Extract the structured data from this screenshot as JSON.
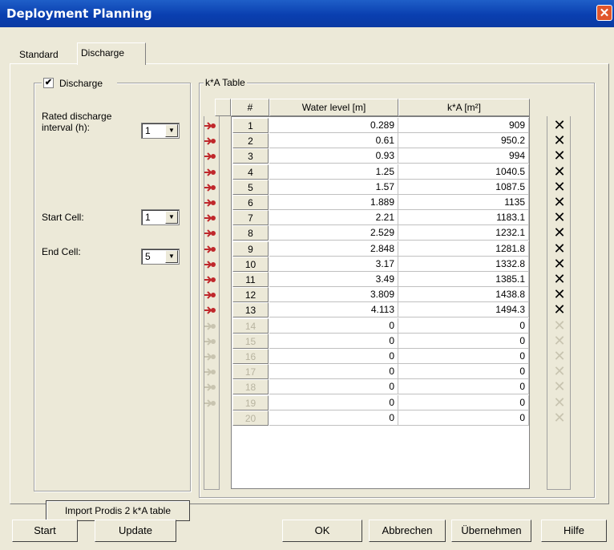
{
  "window": {
    "title": "Deployment Planning",
    "close_glyph": "✕"
  },
  "tabs": [
    {
      "label": "Standard"
    },
    {
      "label": "Discharge"
    }
  ],
  "discharge_group": {
    "checkbox_label": "Discharge",
    "checked": true,
    "rated_label_1": "Rated discharge",
    "rated_label_2": "interval (h):",
    "rated_value": "1",
    "start_cell_label": "Start Cell:",
    "start_cell_value": "1",
    "end_cell_label": "End Cell:",
    "end_cell_value": "5"
  },
  "import_button": "Import Prodis 2 k*A table",
  "table": {
    "title": "k*A Table",
    "headers": {
      "num": "#",
      "water": "Water level [m]",
      "ka": "k*A [m²]"
    },
    "rows": [
      {
        "n": "1",
        "w": "0.289",
        "k": "909"
      },
      {
        "n": "2",
        "w": "0.61",
        "k": "950.2"
      },
      {
        "n": "3",
        "w": "0.93",
        "k": "994"
      },
      {
        "n": "4",
        "w": "1.25",
        "k": "1040.5"
      },
      {
        "n": "5",
        "w": "1.57",
        "k": "1087.5"
      },
      {
        "n": "6",
        "w": "1.889",
        "k": "1135"
      },
      {
        "n": "7",
        "w": "2.21",
        "k": "1183.1"
      },
      {
        "n": "8",
        "w": "2.529",
        "k": "1232.1"
      },
      {
        "n": "9",
        "w": "2.848",
        "k": "1281.8"
      },
      {
        "n": "10",
        "w": "3.17",
        "k": "1332.8"
      },
      {
        "n": "11",
        "w": "3.49",
        "k": "1385.1"
      },
      {
        "n": "12",
        "w": "3.809",
        "k": "1438.8"
      },
      {
        "n": "13",
        "w": "4.113",
        "k": "1494.3"
      },
      {
        "n": "14",
        "w": "0",
        "k": "0",
        "disabled": true
      },
      {
        "n": "15",
        "w": "0",
        "k": "0",
        "disabled": true
      },
      {
        "n": "16",
        "w": "0",
        "k": "0",
        "disabled": true
      },
      {
        "n": "17",
        "w": "0",
        "k": "0",
        "disabled": true
      },
      {
        "n": "18",
        "w": "0",
        "k": "0",
        "disabled": true
      },
      {
        "n": "19",
        "w": "0",
        "k": "0",
        "disabled": true
      },
      {
        "n": "20",
        "w": "0",
        "k": "0",
        "disabled": true
      }
    ]
  },
  "buttons": {
    "start": "Start",
    "update": "Update",
    "ok": "OK",
    "cancel": "Abbrechen",
    "apply": "Übernehmen",
    "help": "Hilfe"
  },
  "colors": {
    "title_bar": "#0a3fb0",
    "insert_icon": "#c0282c",
    "delete_icon": "#000000"
  },
  "icons": {
    "insert": "insert-row-icon",
    "delete": "delete-row-icon"
  }
}
